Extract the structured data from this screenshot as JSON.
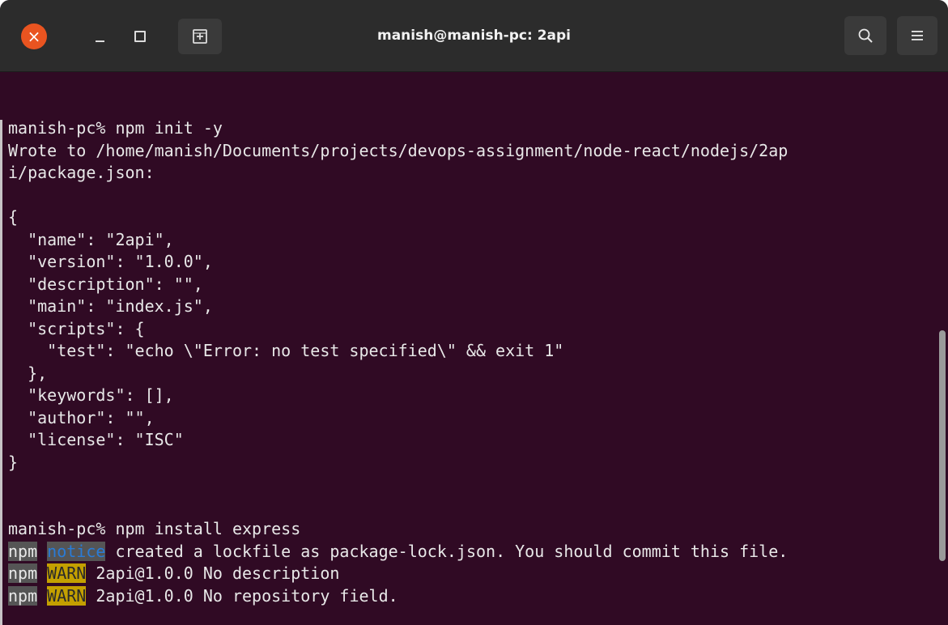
{
  "window": {
    "title": "manish@manish-pc: 2api",
    "close_glyph": "×",
    "icons": [
      "close-icon",
      "minimize-icon",
      "maximize-icon",
      "new-tab-icon",
      "search-icon",
      "hamburger-menu-icon"
    ]
  },
  "terminal": {
    "lines": [
      "manish-pc% npm init -y",
      "Wrote to /home/manish/Documents/projects/devops-assignment/node-react/nodejs/2ap",
      "i/package.json:",
      "",
      "{",
      "  \"name\": \"2api\",",
      "  \"version\": \"1.0.0\",",
      "  \"description\": \"\",",
      "  \"main\": \"index.js\",",
      "  \"scripts\": {",
      "    \"test\": \"echo \\\"Error: no test specified\\\" && exit 1\"",
      "  },",
      "  \"keywords\": [],",
      "  \"author\": \"\",",
      "  \"license\": \"ISC\"",
      "}",
      "",
      "",
      "manish-pc% npm install express"
    ],
    "npm_lines": [
      {
        "prefix": "npm",
        "tag": "notice",
        "tag_style": "notice",
        "text": " created a lockfile as package-lock.json. You should commit this file."
      },
      {
        "prefix": "npm",
        "tag": "WARN",
        "tag_style": "warn",
        "text": " 2api@1.0.0 No description"
      },
      {
        "prefix": "npm",
        "tag": "WARN",
        "tag_style": "warn",
        "text": " 2api@1.0.0 No repository field."
      }
    ]
  },
  "colors": {
    "background": "#300a24",
    "titlebar": "#2c2c2c",
    "close_button": "#e95420",
    "warn_bg": "#c4a000",
    "notice_fg": "#2a7bd6"
  }
}
